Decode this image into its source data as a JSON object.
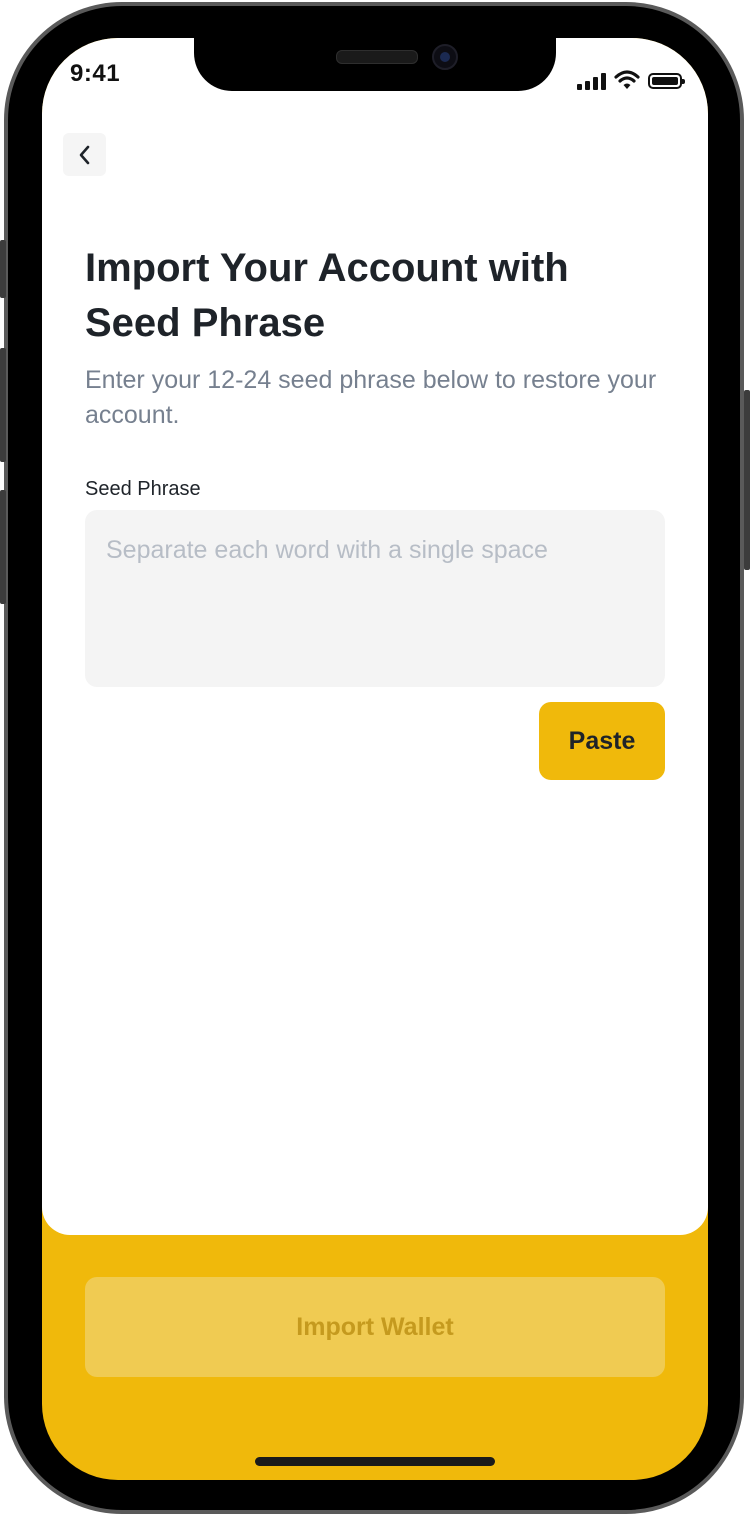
{
  "status_bar": {
    "time": "9:41"
  },
  "header": {
    "back_icon": "chevron-left-icon"
  },
  "main": {
    "title": "Import Your Account with Seed Phrase",
    "subtitle": "Enter your 12-24 seed phrase below to restore your account.",
    "seed_field": {
      "label": "Seed Phrase",
      "placeholder": "Separate each word with a single space",
      "value": ""
    },
    "paste_label": "Paste"
  },
  "footer": {
    "import_label": "Import Wallet"
  },
  "colors": {
    "brand_yellow": "#f0b90b",
    "disabled_button": "#f0cb52",
    "disabled_text": "#c59a1e",
    "title_text": "#1e2329",
    "muted_text": "#76808f",
    "input_background": "#f4f4f4"
  }
}
